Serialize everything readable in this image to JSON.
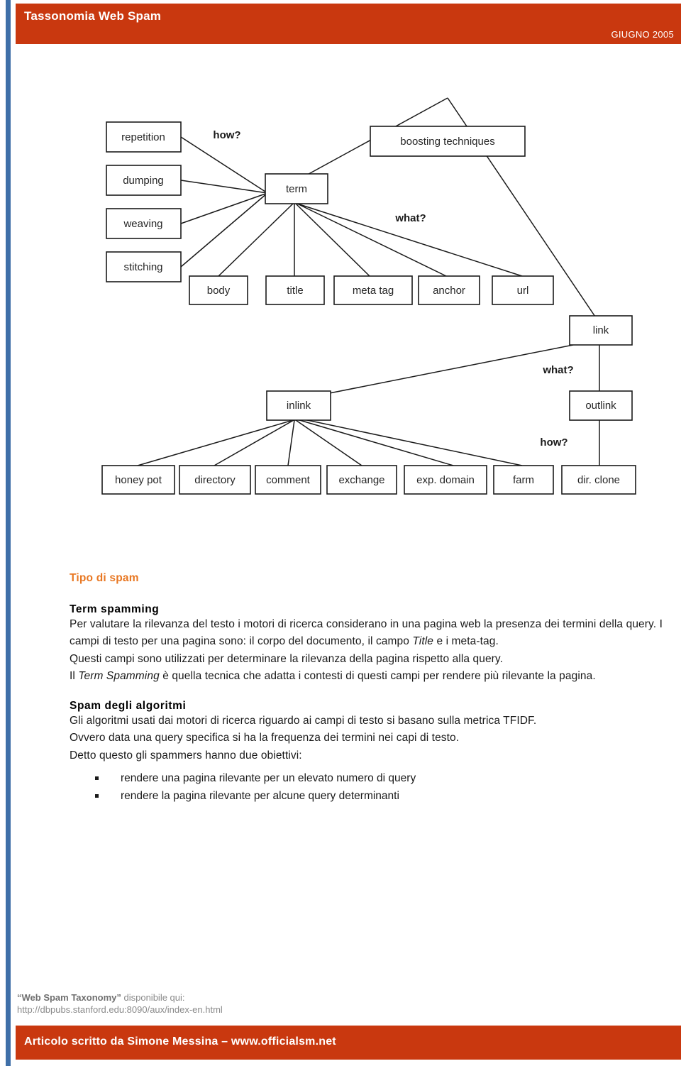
{
  "header": {
    "title": "Tassonomia Web Spam",
    "date": "GIUGNO 2005"
  },
  "diagram": {
    "title": "web-spam-taxonomy-diagram",
    "nodes": {
      "boosting": "boosting techniques",
      "term": "term",
      "repetition": "repetition",
      "dumping": "dumping",
      "weaving": "weaving",
      "stitching": "stitching",
      "body": "body",
      "title": "title",
      "meta_tag": "meta tag",
      "anchor": "anchor",
      "url": "url",
      "link": "link",
      "inlink": "inlink",
      "outlink": "outlink",
      "honey_pot": "honey pot",
      "directory": "directory",
      "comment": "comment",
      "exchange": "exchange",
      "exp_domain": "exp. domain",
      "farm": "farm",
      "dir_clone": "dir. clone"
    },
    "edge_labels": {
      "how_term": "how?",
      "what_term": "what?",
      "what_link": "what?",
      "how_link": "how?"
    }
  },
  "content": {
    "section_heading": "Tipo di spam",
    "term_spamming": {
      "heading": "Term spamming",
      "p1_a": "Per valutare la rilevanza del testo i motori di ricerca considerano in una pagina web la presenza dei termini della query. I campi di testo per una pagina sono: il corpo del documento, il campo ",
      "p1_em": "Title",
      "p1_b": " e i meta-tag.",
      "p2": "Questi campi sono utilizzati per determinare la rilevanza della pagina rispetto alla query.",
      "p3_a": "Il ",
      "p3_em": "Term Spamming",
      "p3_b": " è quella tecnica che adatta i contesti di questi campi per rendere più rilevante la pagina."
    },
    "spam_algoritmi": {
      "heading": "Spam degli algoritmi",
      "p1": "Gli algoritmi usati dai motori di ricerca riguardo ai campi di testo si basano sulla metrica TFIDF.",
      "p2": "Ovvero data una query specifica  si ha la frequenza dei termini nei capi di testo.",
      "p3": "Detto questo gli spammers hanno due obiettivi:",
      "bullets": [
        "rendere una pagina rilevante per un elevato numero di query",
        "rendere la pagina rilevante per alcune query determinanti"
      ]
    }
  },
  "footer": {
    "source_title": "“Web Spam Taxonomy”",
    "source_suffix": " disponibile qui:",
    "source_url": "http://dbpubs.stanford.edu:8090/aux/index-en.html",
    "credit": "Articolo scritto da Simone Messina – www.officialsm.net"
  },
  "colors": {
    "brand_red": "#C9380F",
    "accent_orange": "#E87722",
    "rail_blue": "#3F6FA8"
  }
}
